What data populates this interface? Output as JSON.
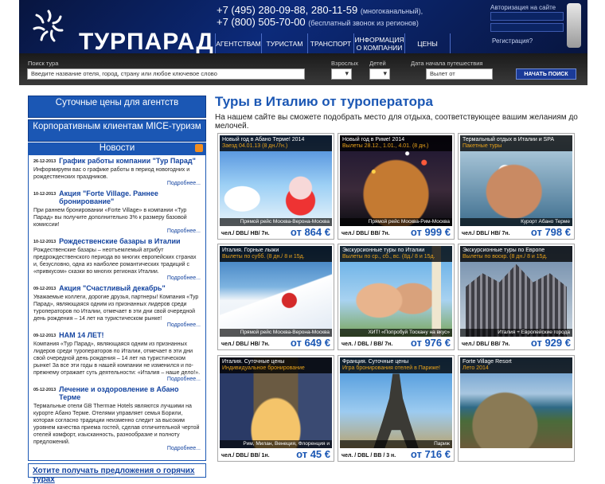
{
  "header": {
    "logo": "ТУРПАРАД",
    "phone1": "+7 (495) 280-09-88, 280-11-59",
    "phone1_note": "(многоканальный),",
    "phone2": "+7 (800) 505-70-00",
    "phone2_note": "(бесплатный звонок из регионов)",
    "nav": [
      "АГЕНТСТВАМ",
      "ТУРИСТАМ",
      "ТРАНСПОРТ",
      "ИНФОРМАЦИЯ О КОМПАНИИ",
      "ЦЕНЫ"
    ],
    "auth_title": "Авторизация на сайте",
    "register": "Регистрация?"
  },
  "search": {
    "tour_label": "Поиск тура",
    "tour_value": "Введите название отеля, город, страну или любое ключевое слово",
    "adults_label": "Взрослых",
    "children_label": "Детей",
    "date_label": "Дата начала путешествия",
    "date_value": "Вылет от",
    "button": "НАЧАТЬ ПОИСК"
  },
  "sidebar": {
    "btn1": "Суточные цены для агентств",
    "btn2": "Корпоративным клиентам MICE-туризм",
    "news_title": "Новости",
    "news": [
      {
        "date": "26-12-2013",
        "title": "График работы компании \"Тур Парад\"",
        "text": "Информируем вас о графике работы в период новогодних и рождественских праздников.",
        "more": "Подробнее..."
      },
      {
        "date": "10-12-2013",
        "title": "Акция \"Forte Village. Раннее бронирование\"",
        "text": "При раннем бронировании «Forte Village» в компании «Тур Парад» вы получите дополнительно 3% к размеру базовой комиссии!",
        "more": "Подробнее..."
      },
      {
        "date": "10-12-2013",
        "title": "Рождественские базары в Италии",
        "text": "Рождественские базары – неотъемлемый атрибут предрождественского периода во многих европейских странах и, безусловно, одна из наиболее романтических традиций с «привкусом» сказки во многих регионах Италии.",
        "more": "Подробнее..."
      },
      {
        "date": "09-12-2013",
        "title": "Акция \"Счастливый декабрь\"",
        "text": "Уважаемые коллеги, дорогие друзья, партнеры! Компания «Тур Парад», являющаяся одним из признанных лидеров среди туроператоров по Италии, отмечает в эти дни свой очередной день рождения – 14 лет на туристическом рынке!",
        "more": "Подробнее..."
      },
      {
        "date": "09-12-2013",
        "title": "НАМ 14 ЛЕТ!",
        "text": "Компания «Тур Парад», являющаяся одним из признанных лидеров среди туроператоров по Италии, отмечает в эти дни свой очередной день рождения – 14 лет на туристическом рынке! За все эти годы в нашей компании не изменился и по-прежнему отражает суть деятельности: «Италия – наше дело!».",
        "more": "Подробнее..."
      },
      {
        "date": "05-12-2013",
        "title": "Лечение и оздоровление в Абано Терме",
        "text": "Термальные отели GB Thermae Hotels являются лучшими на курорте Абано Терме. Отелями управляет семья Борили, которая согласно традиции неизменно следит за высоким уровнем качества приема гостей, сделав отличительной чертой отелей комфорт, изысканность, разнообразие и полноту предложений.",
        "more": "Подробнее..."
      }
    ],
    "hot": "Хотите получать предложения о горячих турах"
  },
  "main": {
    "title": "Туры в Италию от туроператора",
    "subtitle": "На нашем сайте вы сможете подобрать место для отдыха, соответствующее вашим желаниям до мелочей.",
    "cards": [
      {
        "t1": "Новый год в Абано Терме! 2014",
        "t2": "Заезд 04.01.13 (8 дн./7н.)",
        "route": "Прямой рейс Москва-Верона-Москва",
        "cls": "чел./ DBL/ HB/ 7н.",
        "price": "от 864 €"
      },
      {
        "t1": "Новый год в Риме! 2014",
        "t2": "Вылеты 28.12., 1.01., 4.01. (8 дн.)",
        "route": "Прямой рейс Москва-Рим-Москва",
        "cls": "чел./ DBL/ BB/ 7н.",
        "price": "от 999 €"
      },
      {
        "t1": "Термальный отдых в Италии и SPA",
        "t2": "Пакетные туры",
        "route": "Курорт Абано Терме",
        "cls": "чел./ DBL/ HB/ 7н.",
        "price": "от 798 €"
      },
      {
        "t1": "Италия. Горные лыжи",
        "t2": "Вылеты по субб. (8 дн./ 8 и 15д.",
        "route": "Прямой рейс Москва-Верона-Москва",
        "cls": "чел./ DBL/ HB/ 7н.",
        "price": "от 649 €"
      },
      {
        "t1": "Экскурсионные туры по Италии",
        "t2": "Вылеты по ср., сб., вс. (8д./ 8 и 15д.",
        "route": "ХИТ! «Попробуй Тоскану на вкус»",
        "cls": "чел. / DBL / BB/ 7н.",
        "price": "от 976 €"
      },
      {
        "t1": "Экскурсионные туры по Европе",
        "t2": "Вылеты по воскр. (8 дн./ 8 и 15д.",
        "route": "Италия + Европейские города",
        "cls": "чел./ DBL/ BB/ 7н.",
        "price": "от 929 €"
      },
      {
        "t1": "Италия. Суточные цены",
        "t2": "Индивидуальное бронирование",
        "route": "Рим, Милан, Венеция, Флоренция и",
        "cls": "чел./ DBL/ BB/ 1н.",
        "price": "от 45 €"
      },
      {
        "t1": "Франция. Суточные цены",
        "t2": "Игра бронирования отелей в Париже!",
        "route": "Париж",
        "cls": "чел. / DBL / BB / 3 н.",
        "price": "от 716 €"
      },
      {
        "t1": "Forte Village Resort",
        "t2": "Лето 2014",
        "route": "",
        "cls": "",
        "price": ""
      }
    ]
  },
  "colors": {
    "brand_blue": "#1b57b4",
    "header_dark": "#08153f",
    "accent_orange": "#e8a21a"
  }
}
